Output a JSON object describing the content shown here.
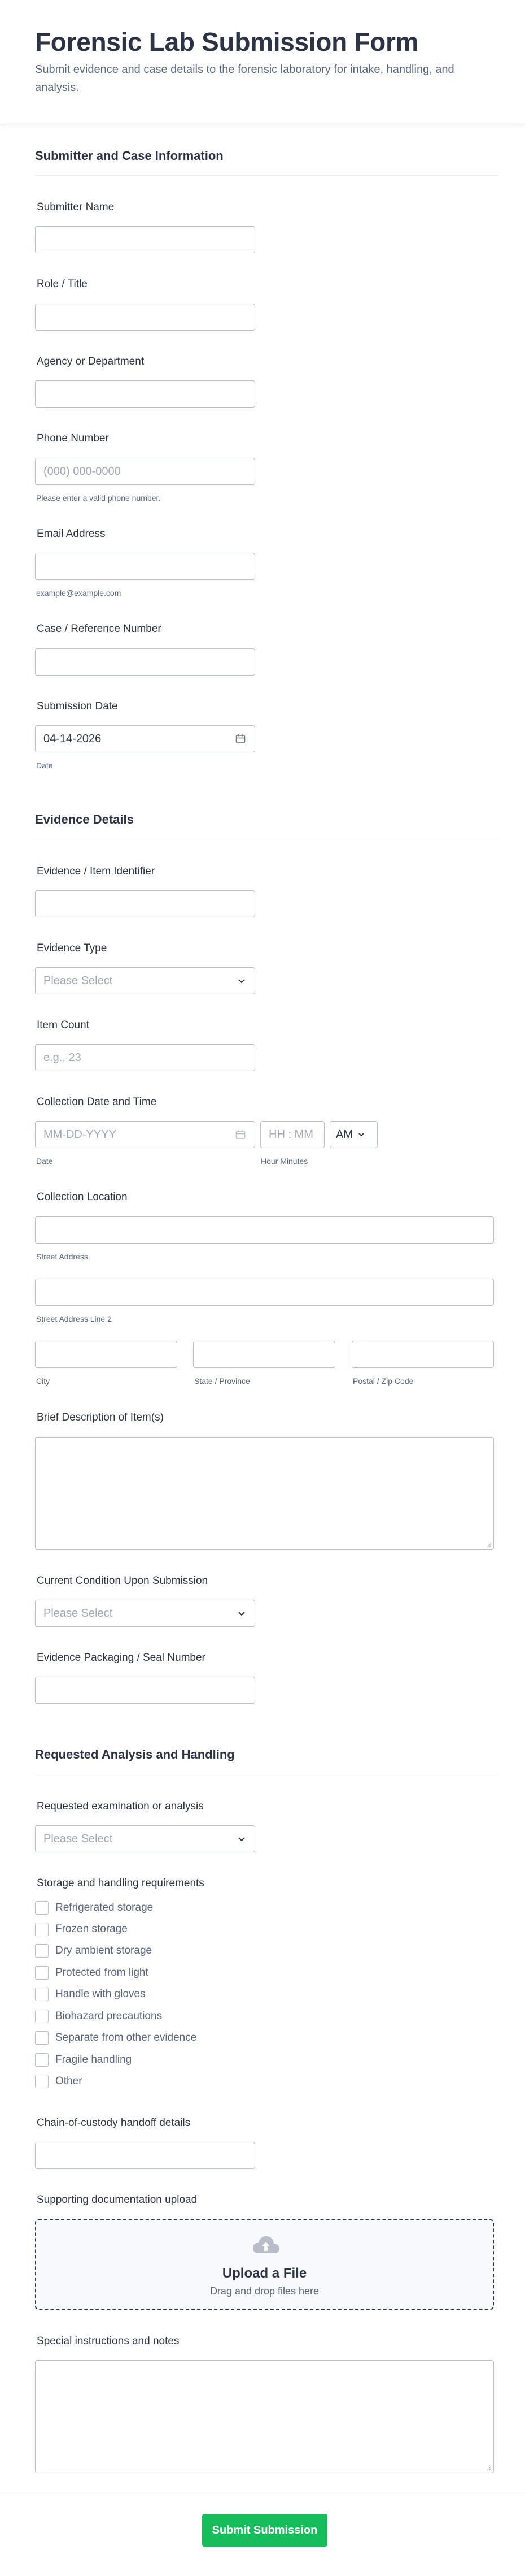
{
  "header": {
    "title": "Forensic Lab Submission Form",
    "subtitle": "Submit evidence and case details to the forensic laboratory for intake, handling, and analysis."
  },
  "sections": {
    "submitter": "Submitter and Case Information",
    "evidence": "Evidence Details",
    "analysis": "Requested Analysis and Handling"
  },
  "fields": {
    "submitter_name": {
      "label": "Submitter Name",
      "value": ""
    },
    "role_title": {
      "label": "Role / Title",
      "value": ""
    },
    "agency": {
      "label": "Agency or Department",
      "value": ""
    },
    "phone": {
      "label": "Phone Number",
      "placeholder": "(000) 000-0000",
      "sublabel": "Please enter a valid phone number."
    },
    "email": {
      "label": "Email Address",
      "sublabel": "example@example.com"
    },
    "case_ref": {
      "label": "Case / Reference Number"
    },
    "submission_date": {
      "label": "Submission Date",
      "value": "04-14-2026",
      "sublabel": "Date"
    },
    "item_id": {
      "label": "Evidence / Item Identifier"
    },
    "evidence_type": {
      "label": "Evidence Type",
      "selected": "Please Select"
    },
    "item_count": {
      "label": "Item Count",
      "placeholder": "e.g., 23"
    },
    "collection_dt": {
      "label": "Collection Date and Time",
      "date_placeholder": "MM-DD-YYYY",
      "time_placeholder": "HH : MM",
      "ampm": "AM",
      "date_sublabel": "Date",
      "time_sublabel": "Hour Minutes"
    },
    "collection_location": {
      "label": "Collection Location",
      "street_sublabel": "Street Address",
      "street2_sublabel": "Street Address Line 2",
      "city_sublabel": "City",
      "state_sublabel": "State / Province",
      "zip_sublabel": "Postal / Zip Code"
    },
    "description": {
      "label": "Brief Description of Item(s)"
    },
    "condition": {
      "label": "Current Condition Upon Submission",
      "selected": "Please Select"
    },
    "packaging": {
      "label": "Evidence Packaging / Seal Number"
    },
    "exam": {
      "label": "Requested examination or analysis",
      "selected": "Please Select"
    },
    "storage": {
      "label": "Storage and handling requirements",
      "options": [
        "Refrigerated storage",
        "Frozen storage",
        "Dry ambient storage",
        "Protected from light",
        "Handle with gloves",
        "Biohazard precautions",
        "Separate from other evidence",
        "Fragile handling",
        "Other"
      ]
    },
    "custody": {
      "label": "Chain-of-custody handoff details"
    },
    "upload": {
      "label": "Supporting documentation upload",
      "title": "Upload a File",
      "subtitle": "Drag and drop files here"
    },
    "instructions": {
      "label": "Special instructions and notes"
    }
  },
  "footer": {
    "submit_label": "Submit Submission"
  },
  "colors": {
    "accent": "#18bd5b",
    "text": "#2c3345",
    "muted": "#57647e",
    "border": "#b8bdc9"
  },
  "icons": {
    "calendar": "calendar-icon",
    "chevron": "chevron-down-icon",
    "upload": "cloud-upload-icon"
  }
}
